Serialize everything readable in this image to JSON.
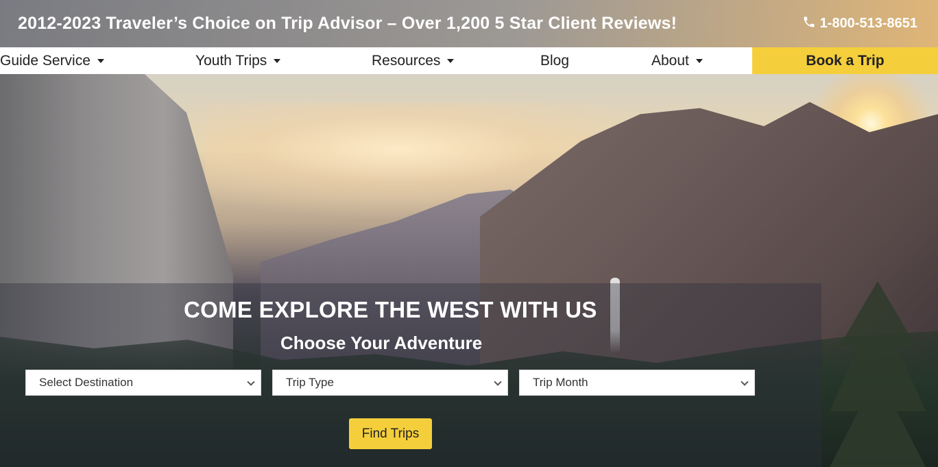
{
  "topbar": {
    "tagline": "2012-2023 Traveler’s Choice on Trip Advisor – Over 1,200 5 Star Client Reviews!",
    "phone": "1-800-513-8651",
    "phone_icon": "phone-icon"
  },
  "nav": {
    "items": [
      {
        "label": "Guide Service",
        "has_dropdown": true
      },
      {
        "label": "Youth Trips",
        "has_dropdown": true
      },
      {
        "label": "Resources",
        "has_dropdown": true
      },
      {
        "label": "Blog",
        "has_dropdown": false
      },
      {
        "label": "About",
        "has_dropdown": true
      }
    ],
    "cta": "Book a Trip"
  },
  "hero": {
    "headline": "COME EXPLORE THE WEST WITH US",
    "subheadline": "Choose Your Adventure"
  },
  "search": {
    "destination": "Select Destination",
    "trip_type": "Trip Type",
    "trip_month": "Trip Month",
    "button": "Find Trips"
  },
  "colors": {
    "accent": "#f5cf3b",
    "nav_bg": "#ffffff",
    "text_dark": "#222222"
  }
}
